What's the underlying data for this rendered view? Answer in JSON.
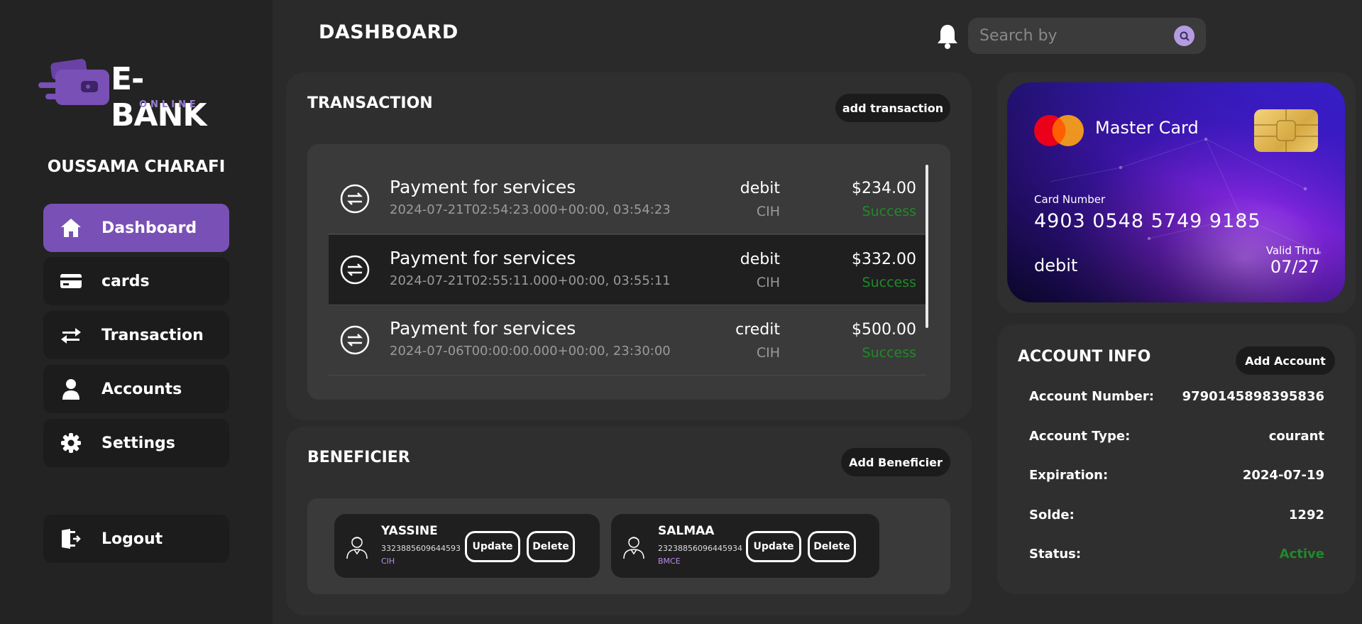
{
  "brand": {
    "name": "E-BANK",
    "subtitle": "ONLINE",
    "accent": "#7950b5"
  },
  "user": {
    "name": "OUSSAMA CHARAFI"
  },
  "sidebar": {
    "items": [
      {
        "label": "Dashboard",
        "icon": "home-icon",
        "active": true
      },
      {
        "label": "cards",
        "icon": "card-icon",
        "active": false
      },
      {
        "label": "Transaction",
        "icon": "transfer-icon",
        "active": false
      },
      {
        "label": "Accounts",
        "icon": "user-icon",
        "active": false
      },
      {
        "label": "Settings",
        "icon": "gear-icon",
        "active": false
      }
    ],
    "logout": {
      "label": "Logout",
      "icon": "logout-icon"
    }
  },
  "header": {
    "title": "DASHBOARD",
    "search_placeholder": "Search by"
  },
  "transactions": {
    "title": "TRANSACTION",
    "add_label": "add transaction",
    "items": [
      {
        "title": "Payment for services",
        "date": "2024-07-21T02:54:23.000+00:00, 03:54:23",
        "type": "debit",
        "bank": "CIH",
        "amount": "$234.00",
        "status": "Success"
      },
      {
        "title": "Payment for services",
        "date": "2024-07-21T02:55:11.000+00:00, 03:55:11",
        "type": "debit",
        "bank": "CIH",
        "amount": "$332.00",
        "status": "Success"
      },
      {
        "title": "Payment for services",
        "date": "2024-07-06T00:00:00.000+00:00, 23:30:00",
        "type": "credit",
        "bank": "CIH",
        "amount": "$500.00",
        "status": "Success"
      }
    ]
  },
  "beneficiaries": {
    "title": "BENEFICIER",
    "add_label": "Add Beneficier",
    "update_label": "Update",
    "delete_label": "Delete",
    "items": [
      {
        "name": "YASSINE",
        "number": "3323885609644593",
        "bank": "CIH"
      },
      {
        "name": "SALMAA",
        "number": "23238856096445934",
        "bank": "BMCE"
      }
    ]
  },
  "card": {
    "brand": "Master Card",
    "number_label": "Card Number",
    "number": "4903 0548 5749 9185",
    "type": "debit",
    "valid_label": "Valid Thru",
    "valid": "07/27"
  },
  "account_info": {
    "title": "ACCOUNT INFO",
    "add_label": "Add Account",
    "rows": [
      {
        "label": "Account Number:",
        "value": "9790145898395836"
      },
      {
        "label": "Account Type:",
        "value": "courant"
      },
      {
        "label": "Expiration:",
        "value": "2024-07-19"
      },
      {
        "label": "Solde:",
        "value": "1292"
      },
      {
        "label": "Status:",
        "value": "Active"
      }
    ],
    "status_color": "#1f8a2a"
  }
}
